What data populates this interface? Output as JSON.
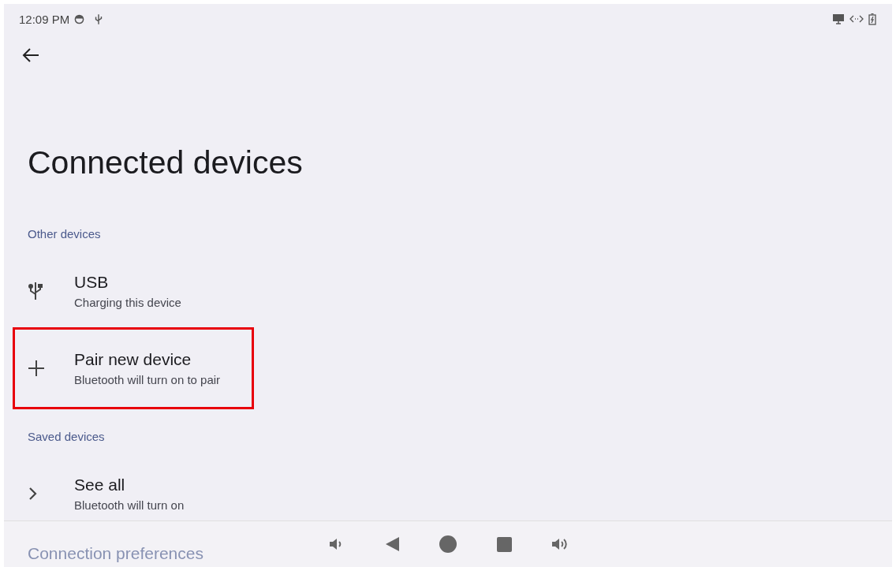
{
  "status_bar": {
    "time": "12:09 PM"
  },
  "page": {
    "title": "Connected devices"
  },
  "sections": [
    {
      "heading": "Other devices",
      "items": [
        {
          "kind": "usb",
          "title": "USB",
          "subtitle": "Charging this device",
          "highlighted": false
        },
        {
          "kind": "add",
          "title": "Pair new device",
          "subtitle": "Bluetooth will turn on to pair",
          "highlighted": true
        }
      ]
    },
    {
      "heading": "Saved devices",
      "items": [
        {
          "kind": "chevron",
          "title": "See all",
          "subtitle": "Bluetooth will turn on",
          "highlighted": false
        }
      ]
    },
    {
      "heading": "Connection preferences"
    }
  ]
}
